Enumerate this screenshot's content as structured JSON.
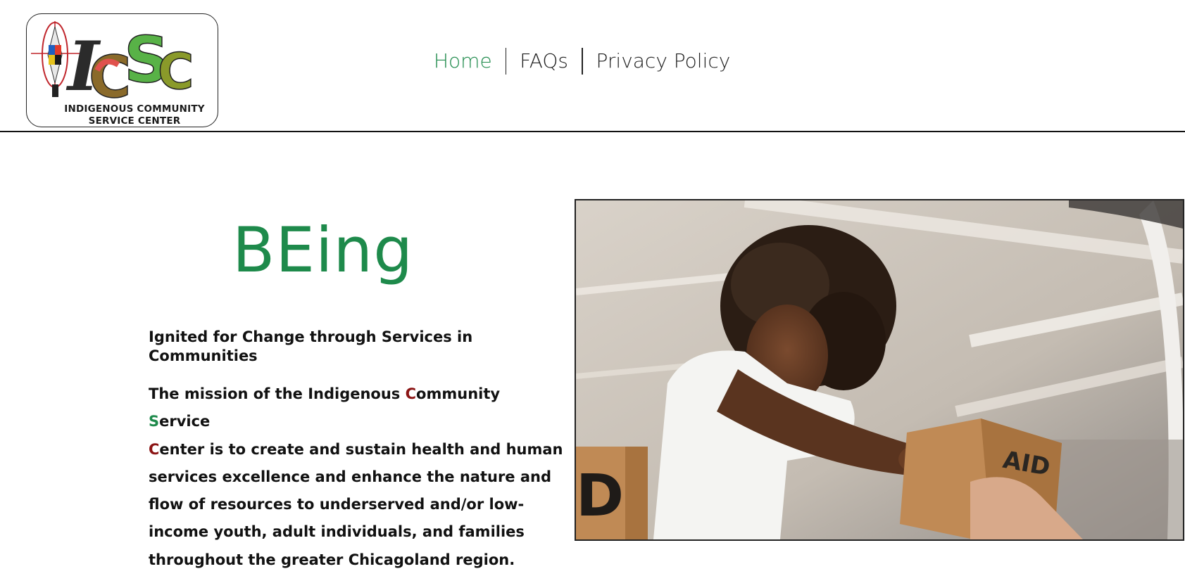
{
  "logo": {
    "letters": "ICSC",
    "caption_line1": "INDIGENOUS COMMUNITY",
    "caption_line2": "SERVICE CENTER"
  },
  "nav": {
    "items": [
      {
        "label": "Home",
        "active": true
      },
      {
        "label": "FAQs",
        "active": false
      },
      {
        "label": "Privacy Policy",
        "active": false
      }
    ]
  },
  "hero": {
    "title": "BEing",
    "tagline": "Ignited for Change through Services in Communities",
    "mission": {
      "p1": "The mission of the Indigenous ",
      "c1": "C",
      "p2": "ommunity ",
      "s1": "S",
      "p3": "ervice",
      "c2": "C",
      "p4": "enter is to create and sustain health and human services excellence and enhance the nature and flow of resources to underserved and/or low-income youth, adult individuals, and families throughout the greater Chicagoland region."
    },
    "photo_box_left_text": "D",
    "photo_box_right_text": "AID"
  },
  "colors": {
    "accent_green": "#1e8a4b",
    "accent_red": "#8b1414",
    "text": "#111111"
  }
}
